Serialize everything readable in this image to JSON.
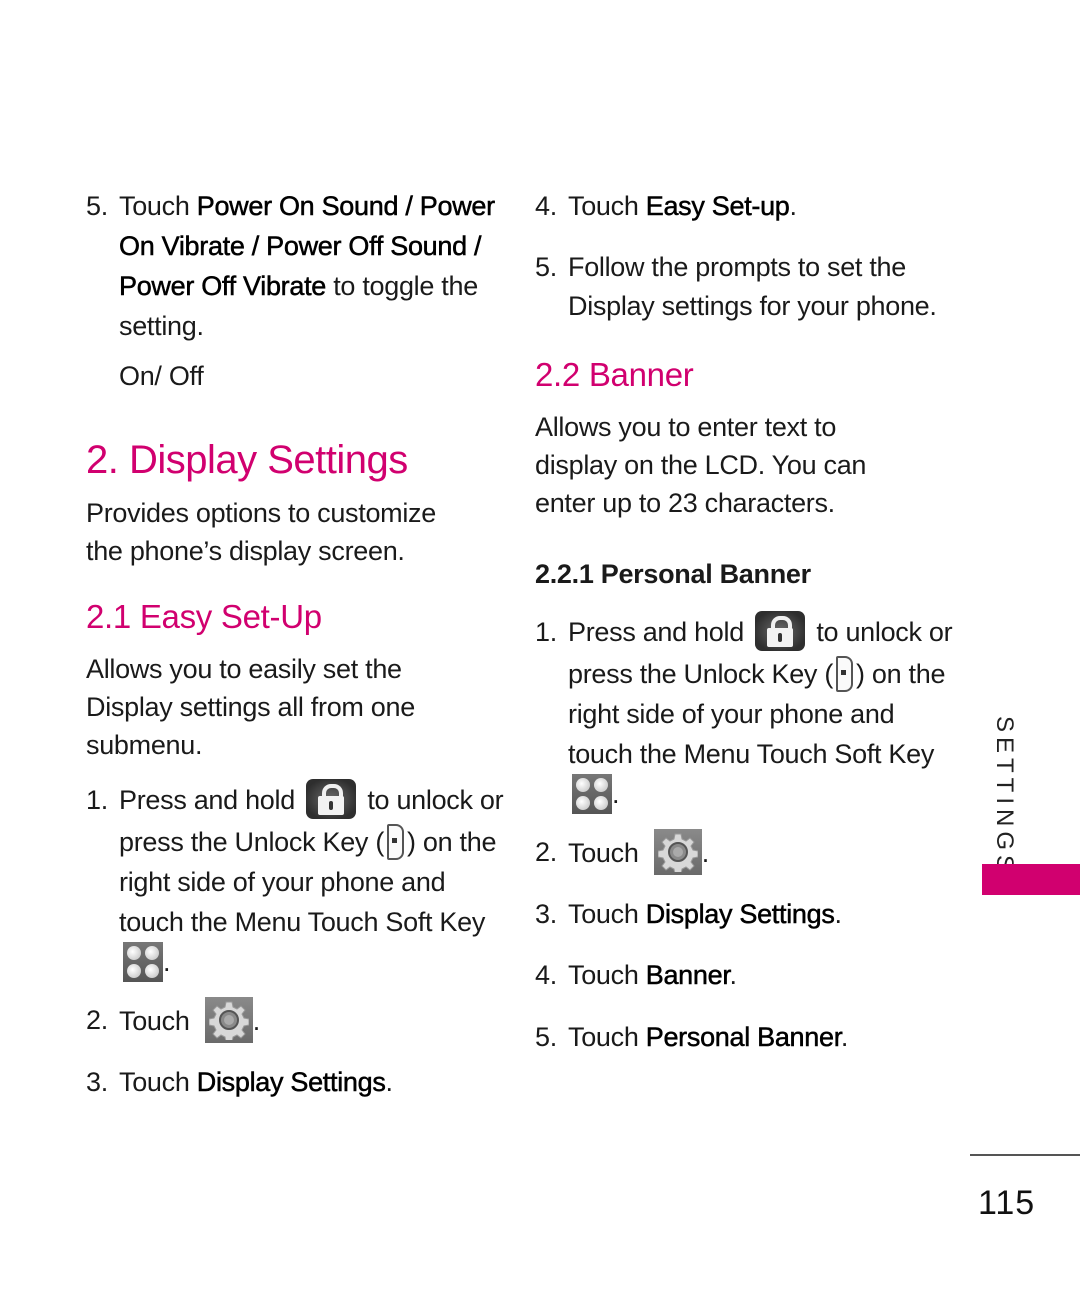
{
  "left_column": {
    "step5": {
      "num": "5.",
      "prefix": "Touch ",
      "bold": "Power On Sound / Power On Vibrate / Power Off Sound / Power Off Vibrate",
      "suffix": " to toggle the setting.",
      "options": "On/ Off"
    },
    "section_title": "2. Display Settings",
    "section_desc": "Provides options to customize the phone’s display screen.",
    "subsection_title": "2.1 Easy Set-Up",
    "subsection_desc": "Allows you to easily set the Display settings all from one submenu.",
    "steps": [
      {
        "num": "1.",
        "text_a": "Press and hold ",
        "text_b": " to unlock or press the Unlock Key (",
        "text_c": ") on the right side of your phone and touch the Menu Touch Soft Key ",
        "text_d": "."
      },
      {
        "num": "2.",
        "text_a": "Touch ",
        "text_b": "."
      },
      {
        "num": "3.",
        "text_a": "Touch ",
        "bold": "Display Settings",
        "text_b": "."
      }
    ]
  },
  "right_column": {
    "steps_top": [
      {
        "num": "4.",
        "text_a": "Touch ",
        "bold": "Easy Set-up",
        "text_b": "."
      },
      {
        "num": "5.",
        "text_a": "Follow the prompts to set the Display settings for your phone."
      }
    ],
    "subsection_title": "2.2 Banner",
    "subsection_desc": "Allows you to enter text to display on the LCD. You can enter up to 23 characters.",
    "sub_subsection_title": "2.2.1 Personal Banner",
    "steps": [
      {
        "num": "1.",
        "text_a": "Press and hold ",
        "text_b": " to unlock or press the Unlock Key (",
        "text_c": ") on the right side of your phone and touch the Menu Touch Soft Key ",
        "text_d": "."
      },
      {
        "num": "2.",
        "text_a": "Touch ",
        "text_b": "."
      },
      {
        "num": "3.",
        "text_a": "Touch ",
        "bold": "Display Settings",
        "text_b": "."
      },
      {
        "num": "4.",
        "text_a": "Touch ",
        "bold": "Banner",
        "text_b": "."
      },
      {
        "num": "5.",
        "text_a": "Touch ",
        "bold": "Personal Banner",
        "text_b": "."
      }
    ]
  },
  "sidebar": {
    "section_label": "SETTINGS",
    "accent_color": "#D1006F"
  },
  "page_number": "115",
  "icons": {
    "lock": "lock-icon",
    "unlock_key": "side-key-icon",
    "menu": "menu-grid-icon",
    "settings": "gear-icon"
  }
}
